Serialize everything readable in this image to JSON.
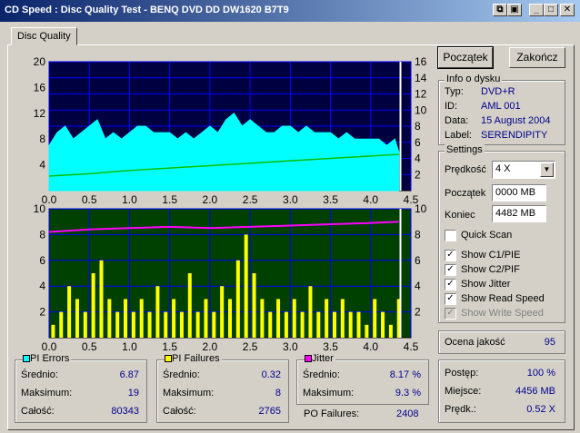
{
  "window": {
    "title": "CD Speed : Disc Quality Test - BENQ    DVD DD DW1620    B7T9"
  },
  "tabs": [
    {
      "label": "Disc Quality"
    }
  ],
  "buttons": {
    "start": "Początek",
    "end": "Zakończ"
  },
  "disc_info": {
    "title": "Info o dysku",
    "type_label": "Typ:",
    "type_value": "DVD+R",
    "id_label": "ID:",
    "id_value": "AML 001",
    "date_label": "Data:",
    "date_value": "15 August 2004",
    "label_label": "Label:",
    "label_value": "SERENDIPITY"
  },
  "settings": {
    "title": "Settings",
    "speed_label": "Prędkość",
    "speed_value": "4 X",
    "start_label": "Początek",
    "start_value": "0000 MB",
    "end_label": "Koniec",
    "end_value": "4482 MB",
    "quick_scan": "Quick Scan",
    "show_c1": "Show C1/PIE",
    "show_c2": "Show C2/PIF",
    "show_jitter": "Show Jitter",
    "show_read": "Show Read Speed",
    "show_write": "Show Write Speed"
  },
  "quality": {
    "label": "Ocena jakość",
    "value": "95"
  },
  "progress": {
    "progress_label": "Postęp:",
    "progress_value": "100 %",
    "place_label": "Miejsce:",
    "place_value": "4456 MB",
    "speed_label": "Prędk.:",
    "speed_value": "0.52 X"
  },
  "pi_errors": {
    "title": "PI Errors",
    "color": "#00ffff",
    "avg_label": "Średnio:",
    "avg": "6.87",
    "max_label": "Maksimum:",
    "max": "19",
    "total_label": "Całość:",
    "total": "80343"
  },
  "pi_failures": {
    "title": "PI Failures",
    "color": "#ffff00",
    "avg_label": "Średnio:",
    "avg": "0.32",
    "max_label": "Maksimum:",
    "max": "8",
    "total_label": "Całość:",
    "total": "2765"
  },
  "jitter": {
    "title": "Jitter",
    "color": "#ff00ff",
    "avg_label": "Średnio:",
    "avg": "8.17 %",
    "max_label": "Maksimum:",
    "max": "9.3 %"
  },
  "po_failures": {
    "label": "PO Failures:",
    "value": "2408"
  },
  "colors": {
    "top_bg": "#000040",
    "bottom_bg": "#004000",
    "grid": "#0000ff",
    "pie": "#00ffff",
    "pif": "#ffff00",
    "jitter": "#ff00ff",
    "speed": "#00c000"
  },
  "chart_data": [
    {
      "type": "area",
      "name": "PI Errors / Read Speed",
      "x_ticks": [
        "0.0",
        "0.5",
        "1.0",
        "1.5",
        "2.0",
        "2.5",
        "3.0",
        "3.5",
        "4.0",
        "4.5"
      ],
      "xlim": [
        0,
        4.5
      ],
      "y_left_ticks": [
        "20",
        "16",
        "12",
        "8",
        "4"
      ],
      "ylim_left": [
        0,
        20
      ],
      "y_right_ticks": [
        "16",
        "14",
        "12",
        "10",
        "8",
        "6",
        "4",
        "2"
      ],
      "ylim_right": [
        0,
        16
      ],
      "series": [
        {
          "x": [
            0.0,
            0.1,
            0.2,
            0.3,
            0.4,
            0.5,
            0.6,
            0.7,
            0.8,
            0.9,
            1.0,
            1.1,
            1.2,
            1.3,
            1.4,
            1.5,
            1.6,
            1.7,
            1.8,
            1.9,
            2.0,
            2.1,
            2.2,
            2.3,
            2.4,
            2.5,
            2.6,
            2.7,
            2.8,
            2.9,
            3.0,
            3.1,
            3.2,
            3.3,
            3.4,
            3.5,
            3.6,
            3.7,
            3.8,
            3.9,
            4.0,
            4.1,
            4.2,
            4.3,
            4.35
          ],
          "values": [
            7,
            9,
            10,
            8,
            9,
            10,
            11,
            8,
            9,
            8,
            9,
            10,
            10,
            9,
            9,
            9,
            8,
            9,
            8,
            9,
            10,
            9,
            11,
            12,
            10,
            11,
            10,
            9,
            9,
            10,
            10,
            9,
            10,
            9,
            9,
            9,
            8,
            9,
            8,
            8,
            8,
            8,
            7,
            8,
            6
          ]
        },
        {
          "x": [
            0.0,
            0.5,
            1.0,
            1.5,
            2.0,
            2.5,
            3.0,
            3.5,
            4.0,
            4.35
          ],
          "values": [
            1.8,
            2.1,
            2.5,
            2.8,
            3.1,
            3.4,
            3.7,
            4.0,
            4.3,
            4.5
          ]
        }
      ]
    },
    {
      "type": "bar",
      "name": "PI Failures / Jitter",
      "x_ticks": [
        "0.0",
        "0.5",
        "1.0",
        "1.5",
        "2.0",
        "2.5",
        "3.0",
        "3.5",
        "4.0",
        "4.5"
      ],
      "xlim": [
        0,
        4.5
      ],
      "y_left_ticks": [
        "10",
        "8",
        "6",
        "4",
        "2"
      ],
      "ylim_left": [
        0,
        10
      ],
      "y_right_ticks": [
        "10",
        "8",
        "6",
        "4",
        "2"
      ],
      "ylim_right": [
        0,
        10
      ],
      "series": [
        {
          "x": [
            0.05,
            0.15,
            0.25,
            0.35,
            0.45,
            0.55,
            0.65,
            0.75,
            0.85,
            0.95,
            1.05,
            1.15,
            1.25,
            1.35,
            1.45,
            1.55,
            1.65,
            1.75,
            1.85,
            1.95,
            2.05,
            2.15,
            2.25,
            2.35,
            2.45,
            2.55,
            2.65,
            2.75,
            2.85,
            2.95,
            3.05,
            3.15,
            3.25,
            3.35,
            3.45,
            3.55,
            3.65,
            3.75,
            3.85,
            3.95,
            4.05,
            4.15,
            4.25,
            4.35
          ],
          "values": [
            1,
            2,
            4,
            3,
            2,
            5,
            6,
            3,
            2,
            3,
            2,
            3,
            2,
            4,
            2,
            3,
            2,
            5,
            2,
            3,
            2,
            4,
            3,
            6,
            8,
            5,
            3,
            2,
            3,
            2,
            3,
            2,
            4,
            2,
            3,
            2,
            3,
            2,
            2,
            1,
            3,
            2,
            1,
            3
          ]
        },
        {
          "x": [
            0.0,
            0.5,
            1.0,
            1.5,
            2.0,
            2.5,
            3.0,
            3.5,
            4.0,
            4.35
          ],
          "values": [
            8.2,
            8.4,
            8.5,
            8.6,
            8.5,
            8.6,
            8.7,
            8.8,
            8.9,
            9.0
          ]
        }
      ]
    }
  ]
}
